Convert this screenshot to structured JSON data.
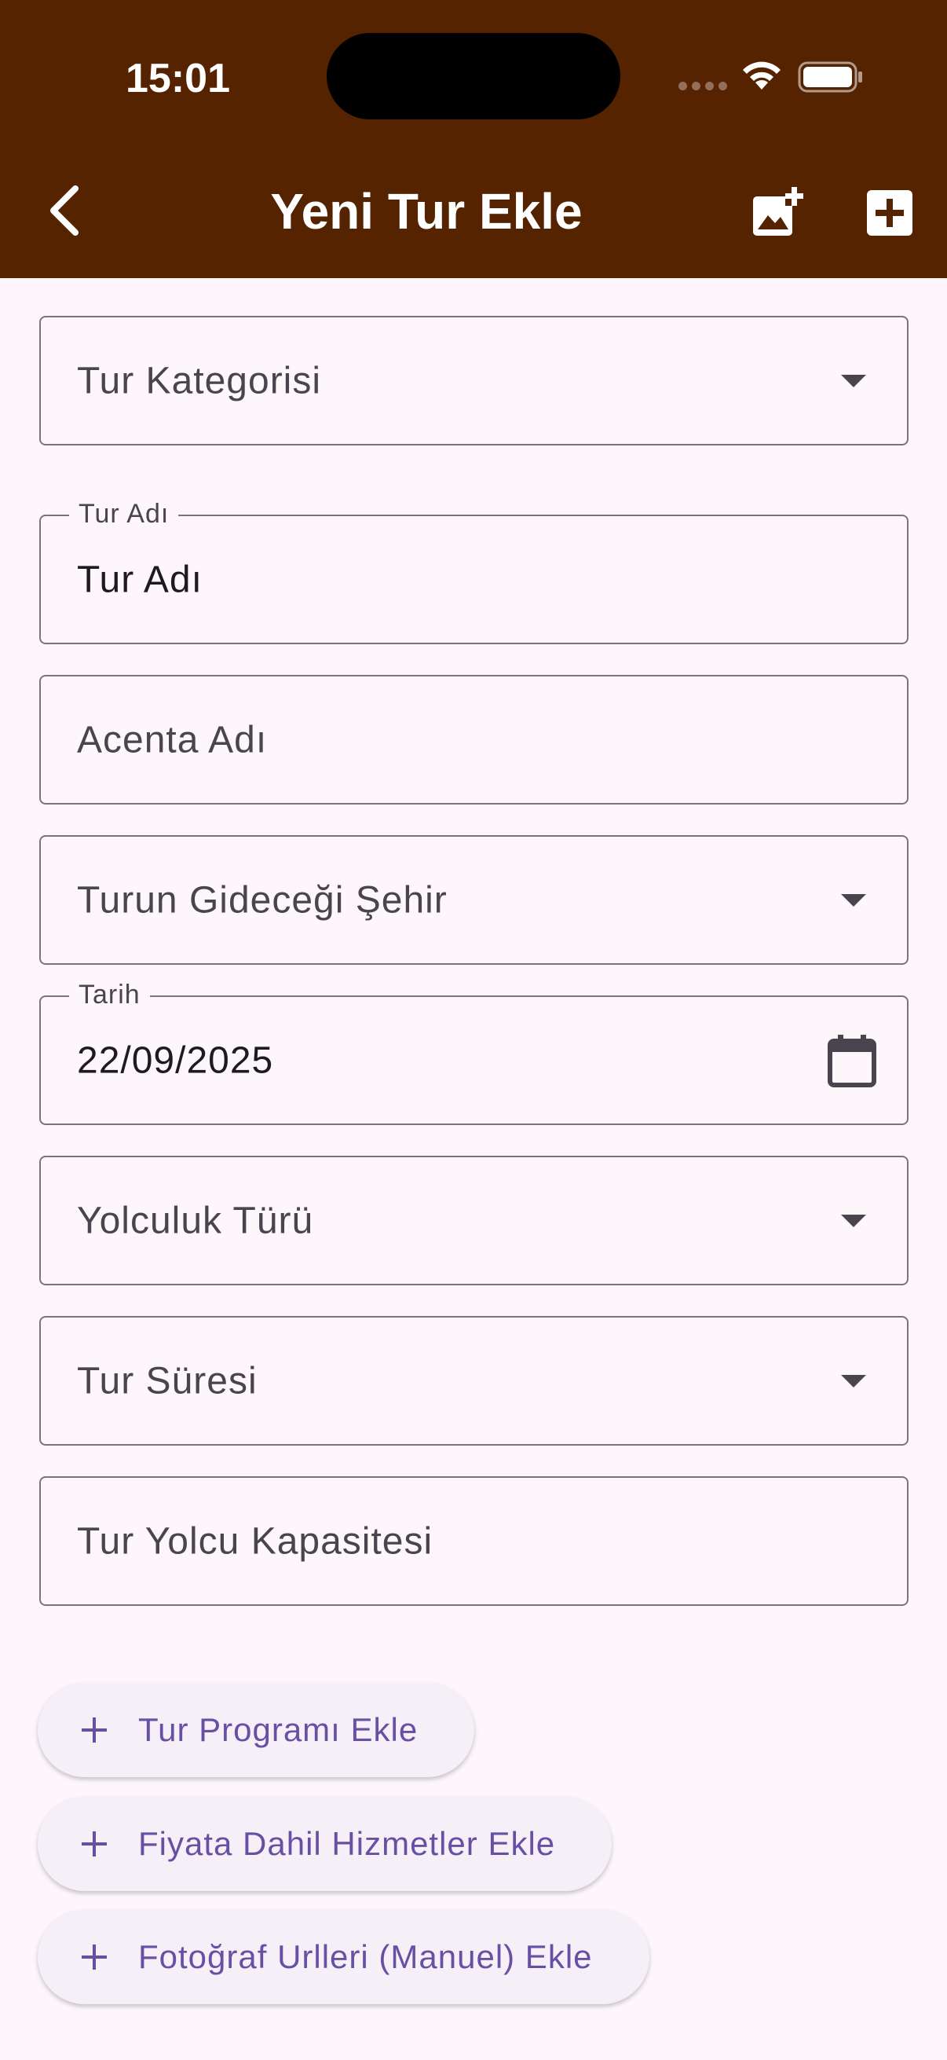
{
  "status_bar": {
    "time": "15:01"
  },
  "app_bar": {
    "title": "Yeni Tur Ekle",
    "back_icon": "chevron-left-icon",
    "actions": [
      "add-photo-icon",
      "add-box-icon"
    ]
  },
  "form": {
    "tour_category": {
      "placeholder": "Tur Kategorisi"
    },
    "tour_name": {
      "label": "Tur Adı",
      "value": "Tur Adı"
    },
    "agency_name": {
      "placeholder": "Acenta Adı"
    },
    "destination_city": {
      "placeholder": "Turun Gideceği Şehir"
    },
    "date": {
      "label": "Tarih",
      "value": "22/09/2025"
    },
    "travel_type": {
      "placeholder": "Yolculuk Türü"
    },
    "tour_duration": {
      "placeholder": "Tur Süresi"
    },
    "passenger_capacity": {
      "placeholder": "Tur Yolcu Kapasitesi"
    }
  },
  "buttons": {
    "add_program": "Tur Programı Ekle",
    "add_included_services": "Fiyata Dahil Hizmetler Ekle",
    "add_photo_urls": "Fotoğraf Urlleri (Manuel) Ekle"
  },
  "colors": {
    "app_bar": "#562300",
    "background": "#fdf7fc",
    "accent": "#6750a4",
    "outline": "#79747e"
  }
}
